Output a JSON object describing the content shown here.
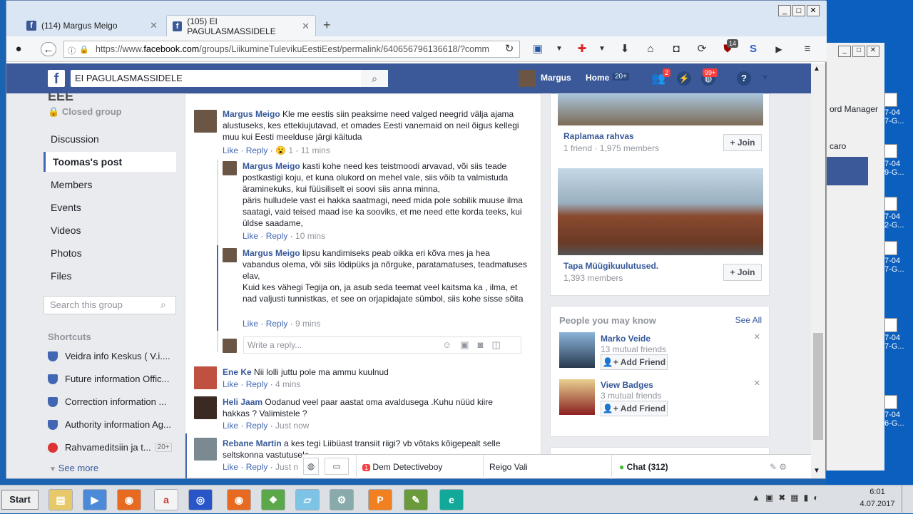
{
  "browser": {
    "tabs": [
      {
        "label": "(114) Margus Meigo"
      },
      {
        "label": "(105) EI PAGULASMASSIDELE"
      }
    ],
    "url_prefix": "https://www.",
    "url_domain": "facebook.com",
    "url_rest": "/groups/LiikumineTulevikuEestiEest/permalink/640656796136618/?comm"
  },
  "fbbar": {
    "search_value": "EI PAGULASMASSIDELE",
    "user": "Margus",
    "home": "Home",
    "home_count": "20+",
    "friends_badge": "2",
    "notif_badge": "99+"
  },
  "left": {
    "group_name_partial": "EEE",
    "closed": "Closed group",
    "nav": [
      "Discussion",
      "Toomas's post",
      "Members",
      "Events",
      "Videos",
      "Photos",
      "Files"
    ],
    "search_placeholder": "Search this group",
    "shortcuts_header": "Shortcuts",
    "shortcuts": [
      "Veidra info Keskus ( V.i....",
      "Future information Offic...",
      "Correction information ...",
      "Authority information Ag...",
      "Rahvameditsiin ja t..."
    ],
    "shortcut_badge": "20+",
    "see_more": "See more"
  },
  "comments": [
    {
      "name": "Margus Meigo",
      "text": "Kle me eestis siin peaksime need valged neegrid välja ajama alustuseks, kes ettekiujutavad, et omades Eesti vanemaid on neil õigus kellegi muu kui Eesti meelduse järgi käituda",
      "like": "Like",
      "reply": "Reply",
      "reaction_count": "1",
      "time": "11 mins"
    },
    {
      "name": "Margus Meigo",
      "text": "kasti kohe need kes teistmoodi arvavad, või siis teade postkastigi koju, et kuna olukord on mehel vale, siis võib ta valmistuda äraminekuks, kui füüsiliselt ei soovi siis anna minna,",
      "text2": "päris hulludele vast ei hakka saatmagi, need mida pole sobilik muuse ilma saatagi, vaid teised maad ise ka sooviks, et me need ette korda teeks, kui üldse saadame,",
      "like": "Like",
      "reply": "Reply",
      "time": "10 mins"
    },
    {
      "name": "Margus Meigo",
      "text": "lipsu kandimiseks peab oikka eri kõva mes ja hea vabandus olema, või siis lödipüks ja nõrguke, paratamatuses, teadmatuses elav,",
      "text2": "Kuid kes vähegi Tegija on, ja asub seda teemat veel kaitsma ka , ilma, et nad valjusti tunnistkas, et see on orjapidajate sümbol, siis kohe sisse sõita",
      "like": "Like",
      "reply": "Reply",
      "time": "9 mins"
    },
    {
      "name": "Ene Ke",
      "text": "Nii lolli juttu pole ma ammu kuulnud",
      "like": "Like",
      "reply": "Reply",
      "time": "4 mins"
    },
    {
      "name": "Heli Jaam",
      "text": "Oodanud veel paar aastat oma avaldusega .Kuhu nüüd kiire hakkas ? Valimistele ?",
      "like": "Like",
      "reply": "Reply",
      "time": "Just now"
    },
    {
      "name": "Rebane Martin",
      "text": "a kes tegi Liibüast transiit riigi? vb võtaks kõigepealt selle seltskonna vastutusele.",
      "like": "Like",
      "reply": "Reply",
      "time": "Just n"
    }
  ],
  "reply_placeholder": "Write a reply...",
  "right": {
    "groups": [
      {
        "name": "Raplamaa rahvas",
        "meta": "1 friend · 1,975 members",
        "join": "+ Join"
      },
      {
        "name": "Tapa Müügikuulutused.",
        "meta": "1,393 members",
        "join": "+ Join"
      }
    ],
    "pymk_title": "People you may know",
    "see_all": "See All",
    "people": [
      {
        "name": "Marko Veide",
        "mutual": "13 mutual friends",
        "add": "Add Friend"
      },
      {
        "name": "View Badges",
        "mutual": "3 mutual friends",
        "add": "Add Friend"
      }
    ]
  },
  "chatbar": {
    "item1": "Dem Detectiveboy",
    "item1_badge": "1",
    "item2": "Reigo Vali",
    "chat": "Chat (312)"
  },
  "taskbar": {
    "start": "Start",
    "time": "6:01",
    "date": "4.07.2017"
  },
  "desktop": {
    "pw_partial": "ord Manager",
    "tab_partial": "caro",
    "labels": [
      "7-04",
      "7-G...",
      "7-04",
      "9-G...",
      "7-04",
      "2-G...",
      "7-04",
      "7-G...",
      "7-04",
      "7-G...",
      "7-04",
      "6-G..."
    ]
  }
}
